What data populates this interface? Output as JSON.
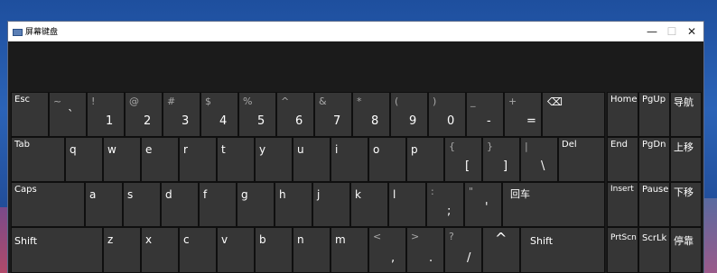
{
  "window": {
    "title": "屏幕键盘",
    "controls": {
      "minimize": "—",
      "maximize": "☐",
      "close": "✕"
    }
  },
  "keys": {
    "esc": "Esc",
    "backtick": {
      "shift": "~",
      "main": "`"
    },
    "n1": {
      "shift": "!",
      "main": "1"
    },
    "n2": {
      "shift": "@",
      "main": "2"
    },
    "n3": {
      "shift": "#",
      "main": "3"
    },
    "n4": {
      "shift": "$",
      "main": "4"
    },
    "n5": {
      "shift": "%",
      "main": "5"
    },
    "n6": {
      "shift": "^",
      "main": "6"
    },
    "n7": {
      "shift": "&",
      "main": "7"
    },
    "n8": {
      "shift": "*",
      "main": "8"
    },
    "n9": {
      "shift": "(",
      "main": "9"
    },
    "n0": {
      "shift": ")",
      "main": "0"
    },
    "minus": {
      "shift": "_",
      "main": "-"
    },
    "equals": {
      "shift": "+",
      "main": "="
    },
    "backspace_icon": "⌫",
    "tab": "Tab",
    "q": "q",
    "w": "w",
    "e": "e",
    "r": "r",
    "t": "t",
    "y": "y",
    "u": "u",
    "i": "i",
    "o": "o",
    "p": "p",
    "lbracket": {
      "shift": "{",
      "main": "["
    },
    "rbracket": {
      "shift": "}",
      "main": "]"
    },
    "backslash": {
      "shift": "|",
      "main": "\\"
    },
    "del": "Del",
    "caps": "Caps",
    "a": "a",
    "s": "s",
    "d": "d",
    "f": "f",
    "g": "g",
    "h": "h",
    "j": "j",
    "k": "k",
    "l": "l",
    "semicolon": {
      "shift": ":",
      "main": ";"
    },
    "quote": {
      "shift": "\"",
      "main": "'"
    },
    "enter": "回车",
    "shift_left": "Shift",
    "z": "z",
    "x": "x",
    "c": "c",
    "v": "v",
    "b": "b",
    "n": "n",
    "m": "m",
    "comma": {
      "shift": "<",
      "main": ","
    },
    "period": {
      "shift": ">",
      "main": "."
    },
    "slash": {
      "shift": "?",
      "main": "/"
    },
    "up_arrow": "^",
    "shift_right": "Shift"
  },
  "nav_keys": {
    "home": "Home",
    "pgup": "PgUp",
    "nav": "导航",
    "end": "End",
    "pgdn": "PgDn",
    "moveup": "上移",
    "insert": "Insert",
    "pause": "Pause",
    "movedown": "下移",
    "prtscn": "PrtScn",
    "scrlk": "ScrLk",
    "dock": "停靠"
  }
}
